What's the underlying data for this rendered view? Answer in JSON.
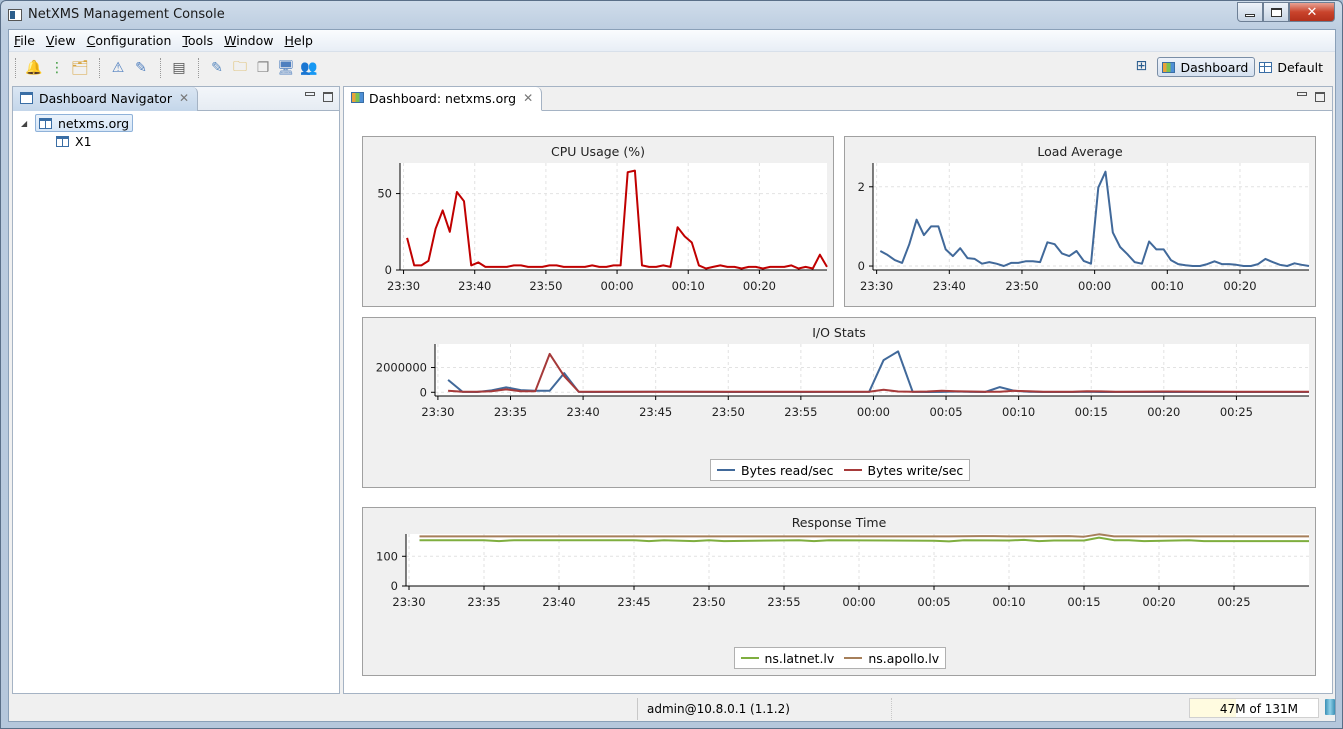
{
  "window": {
    "title": "NetXMS Management Console",
    "controls": {
      "minimize": "minimize",
      "maximize": "maximize",
      "close": "✕"
    }
  },
  "menubar": {
    "items": [
      {
        "label": "File",
        "mnemonic": "F"
      },
      {
        "label": "View",
        "mnemonic": "V"
      },
      {
        "label": "Configuration",
        "mnemonic": "C"
      },
      {
        "label": "Tools",
        "mnemonic": "T"
      },
      {
        "label": "Window",
        "mnemonic": "W"
      },
      {
        "label": "Help",
        "mnemonic": "H"
      }
    ]
  },
  "toolbar": {
    "groups": [
      [
        {
          "icon": "alarm-bell-icon",
          "glyph": "🔔"
        },
        {
          "icon": "object-tree-icon",
          "glyph": "⋮"
        },
        {
          "icon": "map-folder-icon",
          "glyph": "🗂"
        }
      ],
      [
        {
          "icon": "event-warning-icon",
          "glyph": "⚠"
        },
        {
          "icon": "event-edit-icon",
          "glyph": "✎"
        }
      ],
      [
        {
          "icon": "server-log-icon",
          "glyph": "▤"
        }
      ],
      [
        {
          "icon": "configuration-edit-icon",
          "glyph": "✎"
        },
        {
          "icon": "folder-pages-icon",
          "glyph": "🗀"
        },
        {
          "icon": "copy-pages-icon",
          "glyph": "❐"
        },
        {
          "icon": "screen-edit-icon",
          "glyph": "🖥"
        },
        {
          "icon": "users-icon",
          "glyph": "👥"
        }
      ]
    ]
  },
  "perspectives": {
    "open_icon": "open-perspective-icon",
    "items": [
      {
        "label": "Dashboard",
        "active": true
      },
      {
        "label": "Default",
        "active": false
      }
    ]
  },
  "navigator": {
    "tab_label": "Dashboard Navigator",
    "tree": [
      {
        "label": "netxms.org",
        "expanded": true,
        "selected": true,
        "level": 0
      },
      {
        "label": "X1",
        "selected": false,
        "level": 1
      }
    ]
  },
  "dashboard": {
    "tab_label": "Dashboard: netxms.org"
  },
  "statusbar": {
    "user": "admin@10.8.0.1 (1.1.2)",
    "heap": "47M of 131M",
    "heap_used_fraction": 0.36
  },
  "chart_data": [
    {
      "id": "cpu",
      "type": "line",
      "title": "CPU Usage (%)",
      "xlabel": "",
      "ylabel": "",
      "ylim": [
        0,
        70
      ],
      "yticks": [
        0,
        50
      ],
      "ytick_labels": [
        "0",
        "50"
      ],
      "xlim_min": [
        -0.5,
        59.5
      ],
      "xticks": [
        0,
        10,
        20,
        30,
        40,
        50
      ],
      "xtick_labels": [
        "23:30",
        "23:40",
        "23:50",
        "00:00",
        "00:10",
        "00:20"
      ],
      "grid": true,
      "legend": "none",
      "series": [
        {
          "name": "CPU Usage",
          "color": "#c00000",
          "x": [
            0,
            1,
            2,
            3,
            4,
            5,
            6,
            7,
            8,
            9,
            10,
            11,
            12,
            13,
            14,
            15,
            16,
            17,
            18,
            19,
            20,
            21,
            22,
            23,
            24,
            25,
            26,
            27,
            28,
            29,
            30,
            31,
            32,
            33,
            34,
            35,
            36,
            37,
            38,
            39,
            40,
            41,
            42,
            43,
            44,
            45,
            46,
            47,
            48,
            49,
            50,
            51,
            52,
            53,
            54,
            55,
            56,
            57,
            58,
            59
          ],
          "values": [
            21,
            3,
            3,
            6,
            27,
            39,
            25,
            51,
            45,
            3,
            5,
            2,
            2,
            2,
            2,
            3,
            3,
            2,
            2,
            2,
            3,
            3,
            2,
            2,
            2,
            2,
            3,
            2,
            2,
            3,
            3,
            64,
            65,
            3,
            2,
            2,
            3,
            2,
            28,
            22,
            18,
            3,
            1,
            2,
            3,
            2,
            2,
            1,
            2,
            2,
            1,
            2,
            2,
            2,
            3,
            1,
            2,
            1,
            10,
            2
          ],
          "line_x_offset": 0.5
        }
      ]
    },
    {
      "id": "load",
      "type": "line",
      "title": "Load Average",
      "xlabel": "",
      "ylabel": "",
      "ylim": [
        -0.1,
        2.6
      ],
      "yticks": [
        0,
        2
      ],
      "ytick_labels": [
        "0",
        "2"
      ],
      "xlim_min": [
        -0.5,
        59.5
      ],
      "xticks": [
        0,
        10,
        20,
        30,
        40,
        50
      ],
      "xtick_labels": [
        "23:30",
        "23:40",
        "23:50",
        "00:00",
        "00:10",
        "00:20"
      ],
      "grid": true,
      "legend": "none",
      "series": [
        {
          "name": "Load Average",
          "color": "#41699a",
          "x": [
            0,
            1,
            2,
            3,
            4,
            5,
            6,
            7,
            8,
            9,
            10,
            11,
            12,
            13,
            14,
            15,
            16,
            17,
            18,
            19,
            20,
            21,
            22,
            23,
            24,
            25,
            26,
            27,
            28,
            29,
            30,
            31,
            32,
            33,
            34,
            35,
            36,
            37,
            38,
            39,
            40,
            41,
            42,
            43,
            44,
            45,
            46,
            47,
            48,
            49,
            50,
            51,
            52,
            53,
            54,
            55,
            56,
            57,
            58,
            59
          ],
          "values": [
            0.38,
            0.28,
            0.15,
            0.08,
            0.55,
            1.17,
            0.78,
            1.0,
            1.0,
            0.42,
            0.25,
            0.45,
            0.2,
            0.18,
            0.06,
            0.1,
            0.06,
            0.0,
            0.08,
            0.08,
            0.12,
            0.12,
            0.1,
            0.6,
            0.55,
            0.32,
            0.25,
            0.38,
            0.13,
            0.06,
            1.98,
            2.38,
            0.85,
            0.48,
            0.3,
            0.1,
            0.06,
            0.62,
            0.42,
            0.42,
            0.15,
            0.05,
            0.02,
            0.0,
            0.0,
            0.05,
            0.12,
            0.05,
            0.05,
            0.03,
            0.0,
            0.0,
            0.05,
            0.18,
            0.1,
            0.03,
            0.0,
            0.07,
            0.03,
            0.0
          ],
          "line_x_offset": 0.5
        }
      ]
    },
    {
      "id": "io",
      "type": "line",
      "title": "I/O Stats",
      "xlabel": "",
      "ylabel": "",
      "ylim": [
        -300000,
        3900000
      ],
      "yticks": [
        0,
        2000000
      ],
      "ytick_labels": [
        "0",
        "2000000"
      ],
      "xlim_min": [
        -0.2,
        60
      ],
      "xticks": [
        0,
        5,
        10,
        15,
        20,
        25,
        30,
        35,
        40,
        45,
        50,
        55
      ],
      "xtick_labels": [
        "23:30",
        "23:35",
        "23:40",
        "23:45",
        "23:50",
        "23:55",
        "00:00",
        "00:05",
        "00:10",
        "00:15",
        "00:20",
        "00:25"
      ],
      "grid": true,
      "legend": "bottom-center",
      "series": [
        {
          "name": "Bytes read/sec",
          "color": "#41699a",
          "x": [
            0.7,
            1.7,
            2.7,
            3.7,
            4.7,
            5.7,
            6.7,
            7.7,
            8.7,
            9.7,
            10.7,
            15,
            20,
            25,
            29.7,
            30.7,
            31.7,
            32.7,
            33.7,
            34.7,
            35.7,
            36.7,
            37.7,
            38.7,
            39.7,
            40.7,
            41.7,
            42.7,
            43.7,
            44.7,
            45.7,
            46.7,
            50,
            55,
            60
          ],
          "values": [
            1000000,
            30000,
            20000,
            150000,
            400000,
            180000,
            120000,
            120000,
            1550000,
            30000,
            20000,
            40000,
            20000,
            20000,
            30000,
            2600000,
            3300000,
            30000,
            20000,
            30000,
            60000,
            30000,
            20000,
            420000,
            120000,
            40000,
            20000,
            20000,
            20000,
            40000,
            20000,
            20000,
            20000,
            20000,
            20000
          ]
        },
        {
          "name": "Bytes write/sec",
          "color": "#a63a3a",
          "x": [
            0.7,
            1.7,
            2.7,
            3.7,
            4.7,
            5.7,
            6.7,
            7.7,
            8.7,
            9.7,
            10.7,
            15,
            20,
            25,
            29.7,
            30.7,
            31.7,
            32.7,
            33.7,
            34.7,
            35.7,
            36.7,
            37.7,
            38.7,
            39.7,
            40.7,
            41.7,
            42.7,
            43.7,
            44.7,
            45.7,
            46.7,
            50,
            55,
            60
          ],
          "values": [
            120000,
            50000,
            50000,
            80000,
            230000,
            80000,
            80000,
            3100000,
            1300000,
            50000,
            50000,
            50000,
            50000,
            50000,
            50000,
            200000,
            60000,
            50000,
            60000,
            120000,
            90000,
            60000,
            50000,
            50000,
            120000,
            90000,
            50000,
            50000,
            50000,
            80000,
            70000,
            50000,
            60000,
            50000,
            50000
          ]
        }
      ]
    },
    {
      "id": "response",
      "type": "line",
      "title": "Response Time",
      "xlabel": "",
      "ylabel": "",
      "ylim": [
        0,
        175
      ],
      "yticks": [
        0,
        100
      ],
      "ytick_labels": [
        "0",
        "100"
      ],
      "xlim_min": [
        -0.2,
        60
      ],
      "xticks": [
        0,
        5,
        10,
        15,
        20,
        25,
        30,
        35,
        40,
        45,
        50,
        55
      ],
      "xtick_labels": [
        "23:30",
        "23:35",
        "23:40",
        "23:45",
        "23:50",
        "23:55",
        "00:00",
        "00:05",
        "00:10",
        "00:15",
        "00:20",
        "00:25"
      ],
      "grid": true,
      "legend": "bottom-center",
      "series": [
        {
          "name": "ns.latnet.lv",
          "color": "#7fae3f",
          "x": [
            0.7,
            5,
            6,
            7,
            15,
            16,
            17,
            19,
            20,
            21,
            26,
            27,
            28,
            35,
            36,
            37,
            40,
            41,
            42,
            43,
            45,
            46,
            47,
            48,
            49,
            52,
            53,
            55,
            60
          ],
          "values": [
            154,
            154,
            151,
            154,
            154,
            151,
            154,
            151,
            154,
            151,
            154,
            151,
            154,
            152,
            150,
            154,
            153,
            155,
            151,
            153,
            153,
            163,
            154,
            154,
            151,
            154,
            151,
            151,
            151
          ]
        },
        {
          "name": "ns.apollo.lv",
          "color": "#a67f5a",
          "x": [
            0.7,
            30,
            36,
            38,
            39,
            40,
            41,
            44,
            45,
            46,
            47,
            50,
            60
          ],
          "values": [
            167,
            167,
            167,
            168,
            168,
            167,
            167,
            168,
            166,
            174,
            167,
            167,
            167
          ]
        }
      ]
    }
  ]
}
